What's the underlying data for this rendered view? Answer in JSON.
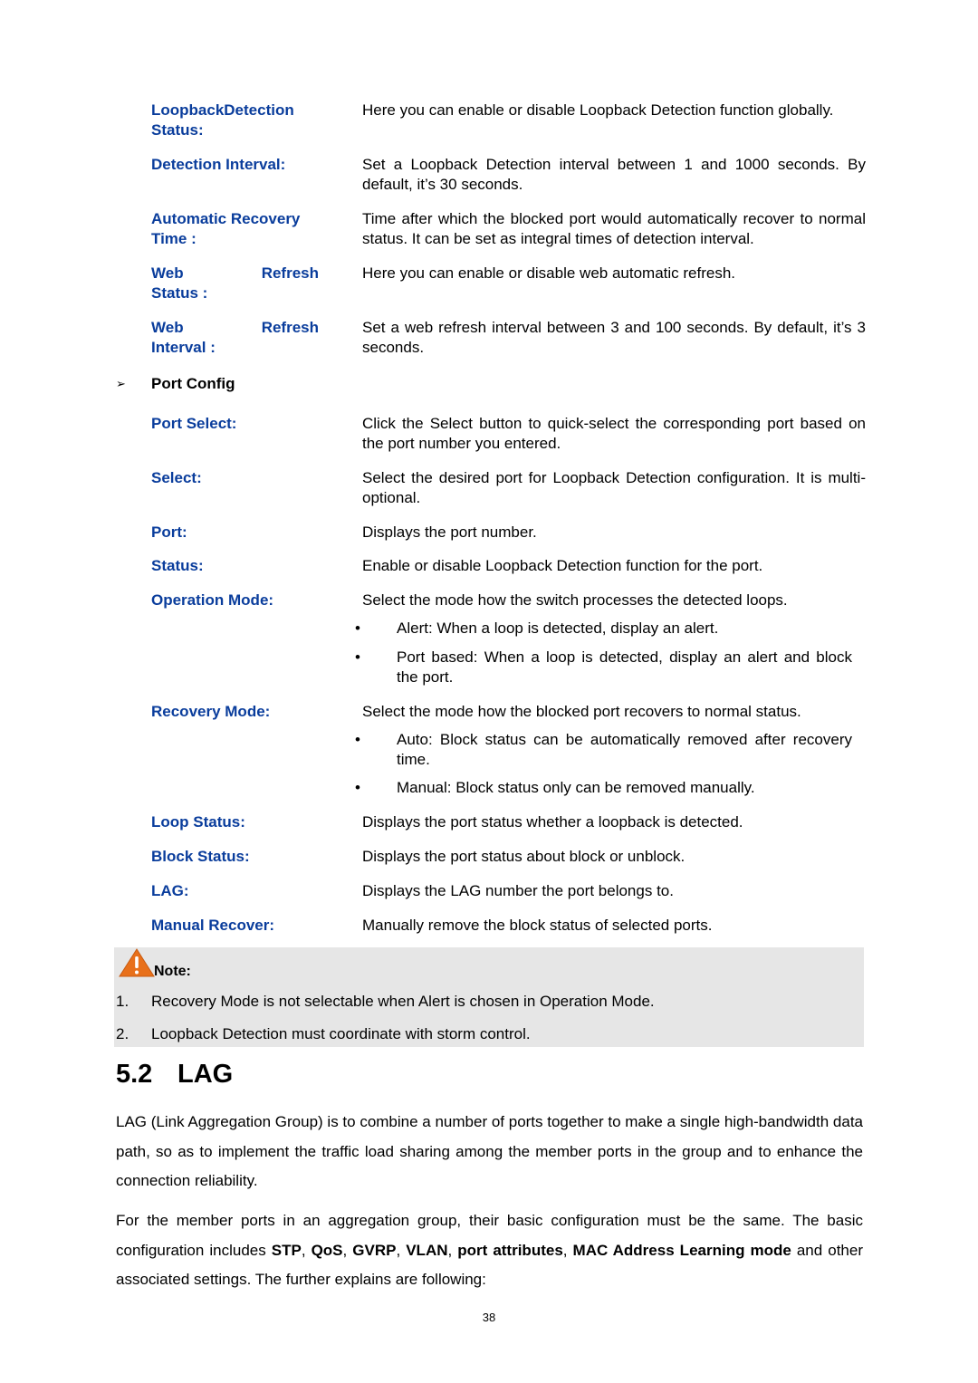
{
  "global_config_items": [
    {
      "term_line1": "LoopbackDetection",
      "term_line2": "Status:",
      "desc": "Here you can enable or disable Loopback Detection function globally."
    },
    {
      "term_line1": "Detection Interval:",
      "term_line2": "",
      "desc": "Set a Loopback Detection interval between 1 and 1000 seconds. By default, it’s 30 seconds."
    },
    {
      "term_line1": "Automatic Recovery",
      "term_line2": "Time :",
      "desc": "Time after which the blocked port would automatically recover to normal status. It can be set as integral times of detection interval."
    },
    {
      "term_line1": "Web Refresh",
      "term_line2": "Status :",
      "desc": "Here you can enable or disable web automatic refresh."
    },
    {
      "term_line1": "Web Refresh",
      "term_line2": "Interval :",
      "desc": "Set a web refresh interval between 3 and 100 seconds. By default, it’s 3 seconds."
    }
  ],
  "port_config": {
    "heading": "Port Config",
    "arrow": "➢",
    "items": [
      {
        "term": "Port Select:",
        "desc": "Click the Select button to quick-select the corresponding port based on the port number you entered."
      },
      {
        "term": "Select:",
        "desc": "Select the desired port for Loopback Detection configuration. It is multi-optional."
      },
      {
        "term": "Port:",
        "desc": "Displays the port number."
      },
      {
        "term": "Status:",
        "desc": "Enable or disable Loopback Detection function for the port."
      },
      {
        "term": "Operation Mode:",
        "desc": "Select the mode how the switch processes the detected loops."
      },
      {
        "term": "Recovery Mode:",
        "desc": "Select the mode how the blocked port recovers to normal status."
      },
      {
        "term": "Loop Status:",
        "desc": "Displays the port status whether a loopback is detected."
      },
      {
        "term": "Block Status:",
        "desc": "Displays the port status about block or unblock."
      },
      {
        "term": "LAG:",
        "desc": "Displays the LAG number the port belongs to."
      },
      {
        "term": "Manual Recover:",
        "desc": "Manually remove the block status of selected ports."
      }
    ],
    "operation_mode_bullets": [
      "Alert: When a loop is detected, display an alert.",
      "Port based: When a loop is detected, display an alert and block the port."
    ],
    "recovery_mode_bullets": [
      "Auto: Block status can be automatically removed after recovery time.",
      "Manual: Block status only can be removed manually."
    ],
    "bullet_glyph": "•"
  },
  "note": {
    "title": "Note:",
    "items": [
      {
        "num": "1.",
        "text": "Recovery Mode is not selectable when Alert is chosen in Operation Mode."
      },
      {
        "num": "2.",
        "text": "Loopback Detection must coordinate with storm control."
      }
    ],
    "icon_color": "#e8701a",
    "background": "#e6e6e6"
  },
  "section": {
    "number": "5.2",
    "title": "LAG",
    "para1": "LAG (Link Aggregation Group) is to combine a number of ports together to make a single high-bandwidth data path, so as to implement the traffic load sharing among the member ports in the group and to enhance the connection reliability.",
    "para2_parts": [
      {
        "t": "For the member ports in an aggregation group, their basic configuration must be the same. The basic configuration includes ",
        "b": false
      },
      {
        "t": "STP",
        "b": true
      },
      {
        "t": ", ",
        "b": false
      },
      {
        "t": "QoS",
        "b": true
      },
      {
        "t": ", ",
        "b": false
      },
      {
        "t": "GVRP",
        "b": true
      },
      {
        "t": ", ",
        "b": false
      },
      {
        "t": "VLAN",
        "b": true
      },
      {
        "t": ", ",
        "b": false
      },
      {
        "t": "port attributes",
        "b": true
      },
      {
        "t": ", ",
        "b": false
      },
      {
        "t": "MAC Address Learning mode",
        "b": true
      },
      {
        "t": " and other associated settings. The further explains are following:",
        "b": false
      }
    ]
  },
  "page_number": "38",
  "colors": {
    "term": "#0a3d9c"
  }
}
